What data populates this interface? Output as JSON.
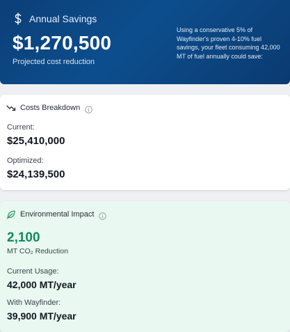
{
  "hero": {
    "title": "Annual Savings",
    "amount": "$1,270,500",
    "subtitle": "Projected cost reduction",
    "note": "Using a conservative 5% of Wayfinder's proven 4-10% fuel savings, your fleet consuming 42,000 MT of fuel annually could save:",
    "icon": "dollar-icon"
  },
  "costs": {
    "title": "Costs Breakdown",
    "icon": "trend-down-icon",
    "current_label": "Current:",
    "current_value": "$25,410,000",
    "optimized_label": "Optimized:",
    "optimized_value": "$24,139,500"
  },
  "environment": {
    "title": "Environmental Impact",
    "icon": "leaf-icon",
    "reduction_value": "2,100",
    "reduction_unit": "MT CO₂ Reduction",
    "current_usage_label": "Current Usage:",
    "current_usage_value": "42,000 MT/year",
    "with_label": "With Wayfinder:",
    "with_value": "39,900 MT/year"
  },
  "colors": {
    "hero_bg": "#0c4e8d",
    "accent_green": "#138a5e",
    "env_bg": "#e9f8f0"
  }
}
